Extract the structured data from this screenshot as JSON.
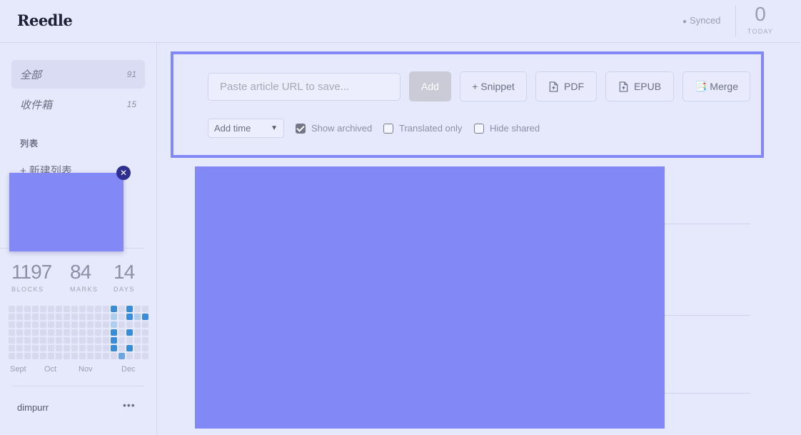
{
  "header": {
    "logo": "Reedle",
    "sync_status": "Synced",
    "today_count": "0",
    "today_label": "TODAY"
  },
  "sidebar": {
    "items": [
      {
        "label": "全部",
        "count": "91"
      },
      {
        "label": "收件箱",
        "count": "15"
      }
    ],
    "section_title": "列表",
    "new_list_label": "+ 新建列表",
    "stats": [
      {
        "value": "1197",
        "label": "BLOCKS"
      },
      {
        "value": "84",
        "label": "MARKS"
      },
      {
        "value": "14",
        "label": "DAYS"
      }
    ],
    "months": [
      "Sept",
      "Oct",
      "Nov",
      "Dec"
    ],
    "activity_levels": [
      [
        0,
        0,
        0,
        0,
        0,
        0,
        0
      ],
      [
        0,
        0,
        0,
        0,
        0,
        0,
        0
      ],
      [
        0,
        0,
        0,
        0,
        0,
        0,
        0
      ],
      [
        0,
        0,
        0,
        0,
        0,
        0,
        0
      ],
      [
        0,
        0,
        0,
        0,
        0,
        0,
        0
      ],
      [
        0,
        0,
        0,
        0,
        0,
        0,
        0
      ],
      [
        0,
        0,
        0,
        0,
        0,
        0,
        0
      ],
      [
        0,
        0,
        0,
        0,
        0,
        0,
        0
      ],
      [
        0,
        0,
        0,
        0,
        0,
        0,
        0
      ],
      [
        0,
        0,
        0,
        0,
        0,
        0,
        0
      ],
      [
        0,
        0,
        0,
        0,
        0,
        0,
        0
      ],
      [
        0,
        0,
        0,
        0,
        0,
        0,
        0
      ],
      [
        0,
        0,
        0,
        0,
        0,
        0,
        0
      ],
      [
        3,
        1,
        1,
        3,
        3,
        3,
        0
      ],
      [
        0,
        0,
        0,
        0,
        0,
        0,
        2
      ],
      [
        3,
        3,
        0,
        3,
        0,
        3,
        0
      ],
      [
        0,
        1,
        0,
        0,
        0,
        0,
        0
      ],
      [
        0,
        3,
        0,
        0,
        0,
        0,
        0
      ]
    ],
    "username": "dimpurr",
    "more_icon": "more-icon"
  },
  "toolbar": {
    "url_placeholder": "Paste article URL to save...",
    "add_label": "Add",
    "snippet_label": "+ Snippet",
    "pdf_label": "PDF",
    "epub_label": "EPUB",
    "merge_label": "📑 Merge",
    "sort_selected": "Add time",
    "show_archived_label": "Show archived",
    "translated_only_label": "Translated only",
    "hide_shared_label": "Hide shared",
    "show_archived_checked": true,
    "translated_only_checked": false,
    "hide_shared_checked": false
  },
  "colors": {
    "accent": "#8289f7",
    "background": "#e6e8fb",
    "heat_high": "#3a8bd8"
  }
}
